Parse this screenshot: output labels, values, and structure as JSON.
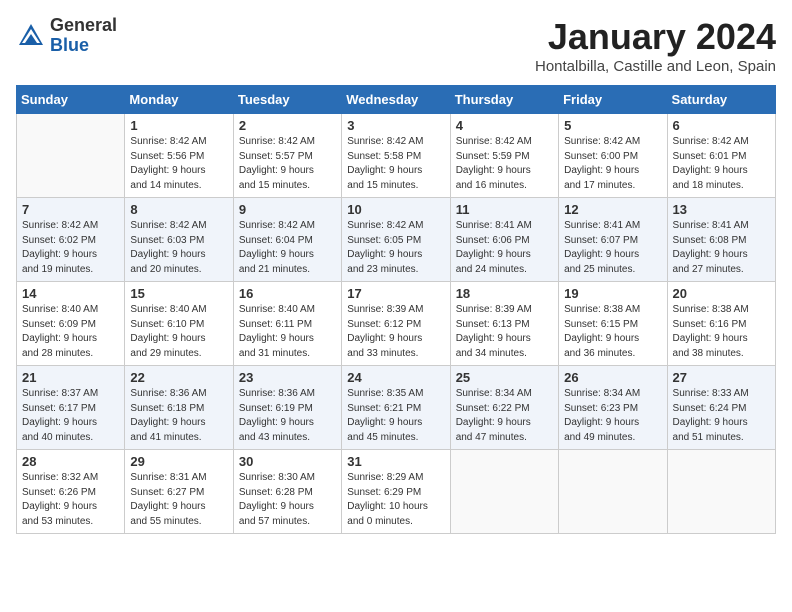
{
  "header": {
    "logo_general": "General",
    "logo_blue": "Blue",
    "month": "January 2024",
    "location": "Hontalbilla, Castille and Leon, Spain"
  },
  "days_of_week": [
    "Sunday",
    "Monday",
    "Tuesday",
    "Wednesday",
    "Thursday",
    "Friday",
    "Saturday"
  ],
  "weeks": [
    [
      {
        "day": "",
        "info": ""
      },
      {
        "day": "1",
        "info": "Sunrise: 8:42 AM\nSunset: 5:56 PM\nDaylight: 9 hours\nand 14 minutes."
      },
      {
        "day": "2",
        "info": "Sunrise: 8:42 AM\nSunset: 5:57 PM\nDaylight: 9 hours\nand 15 minutes."
      },
      {
        "day": "3",
        "info": "Sunrise: 8:42 AM\nSunset: 5:58 PM\nDaylight: 9 hours\nand 15 minutes."
      },
      {
        "day": "4",
        "info": "Sunrise: 8:42 AM\nSunset: 5:59 PM\nDaylight: 9 hours\nand 16 minutes."
      },
      {
        "day": "5",
        "info": "Sunrise: 8:42 AM\nSunset: 6:00 PM\nDaylight: 9 hours\nand 17 minutes."
      },
      {
        "day": "6",
        "info": "Sunrise: 8:42 AM\nSunset: 6:01 PM\nDaylight: 9 hours\nand 18 minutes."
      }
    ],
    [
      {
        "day": "7",
        "info": "Sunrise: 8:42 AM\nSunset: 6:02 PM\nDaylight: 9 hours\nand 19 minutes."
      },
      {
        "day": "8",
        "info": "Sunrise: 8:42 AM\nSunset: 6:03 PM\nDaylight: 9 hours\nand 20 minutes."
      },
      {
        "day": "9",
        "info": "Sunrise: 8:42 AM\nSunset: 6:04 PM\nDaylight: 9 hours\nand 21 minutes."
      },
      {
        "day": "10",
        "info": "Sunrise: 8:42 AM\nSunset: 6:05 PM\nDaylight: 9 hours\nand 23 minutes."
      },
      {
        "day": "11",
        "info": "Sunrise: 8:41 AM\nSunset: 6:06 PM\nDaylight: 9 hours\nand 24 minutes."
      },
      {
        "day": "12",
        "info": "Sunrise: 8:41 AM\nSunset: 6:07 PM\nDaylight: 9 hours\nand 25 minutes."
      },
      {
        "day": "13",
        "info": "Sunrise: 8:41 AM\nSunset: 6:08 PM\nDaylight: 9 hours\nand 27 minutes."
      }
    ],
    [
      {
        "day": "14",
        "info": "Sunrise: 8:40 AM\nSunset: 6:09 PM\nDaylight: 9 hours\nand 28 minutes."
      },
      {
        "day": "15",
        "info": "Sunrise: 8:40 AM\nSunset: 6:10 PM\nDaylight: 9 hours\nand 29 minutes."
      },
      {
        "day": "16",
        "info": "Sunrise: 8:40 AM\nSunset: 6:11 PM\nDaylight: 9 hours\nand 31 minutes."
      },
      {
        "day": "17",
        "info": "Sunrise: 8:39 AM\nSunset: 6:12 PM\nDaylight: 9 hours\nand 33 minutes."
      },
      {
        "day": "18",
        "info": "Sunrise: 8:39 AM\nSunset: 6:13 PM\nDaylight: 9 hours\nand 34 minutes."
      },
      {
        "day": "19",
        "info": "Sunrise: 8:38 AM\nSunset: 6:15 PM\nDaylight: 9 hours\nand 36 minutes."
      },
      {
        "day": "20",
        "info": "Sunrise: 8:38 AM\nSunset: 6:16 PM\nDaylight: 9 hours\nand 38 minutes."
      }
    ],
    [
      {
        "day": "21",
        "info": "Sunrise: 8:37 AM\nSunset: 6:17 PM\nDaylight: 9 hours\nand 40 minutes."
      },
      {
        "day": "22",
        "info": "Sunrise: 8:36 AM\nSunset: 6:18 PM\nDaylight: 9 hours\nand 41 minutes."
      },
      {
        "day": "23",
        "info": "Sunrise: 8:36 AM\nSunset: 6:19 PM\nDaylight: 9 hours\nand 43 minutes."
      },
      {
        "day": "24",
        "info": "Sunrise: 8:35 AM\nSunset: 6:21 PM\nDaylight: 9 hours\nand 45 minutes."
      },
      {
        "day": "25",
        "info": "Sunrise: 8:34 AM\nSunset: 6:22 PM\nDaylight: 9 hours\nand 47 minutes."
      },
      {
        "day": "26",
        "info": "Sunrise: 8:34 AM\nSunset: 6:23 PM\nDaylight: 9 hours\nand 49 minutes."
      },
      {
        "day": "27",
        "info": "Sunrise: 8:33 AM\nSunset: 6:24 PM\nDaylight: 9 hours\nand 51 minutes."
      }
    ],
    [
      {
        "day": "28",
        "info": "Sunrise: 8:32 AM\nSunset: 6:26 PM\nDaylight: 9 hours\nand 53 minutes."
      },
      {
        "day": "29",
        "info": "Sunrise: 8:31 AM\nSunset: 6:27 PM\nDaylight: 9 hours\nand 55 minutes."
      },
      {
        "day": "30",
        "info": "Sunrise: 8:30 AM\nSunset: 6:28 PM\nDaylight: 9 hours\nand 57 minutes."
      },
      {
        "day": "31",
        "info": "Sunrise: 8:29 AM\nSunset: 6:29 PM\nDaylight: 10 hours\nand 0 minutes."
      },
      {
        "day": "",
        "info": ""
      },
      {
        "day": "",
        "info": ""
      },
      {
        "day": "",
        "info": ""
      }
    ]
  ]
}
